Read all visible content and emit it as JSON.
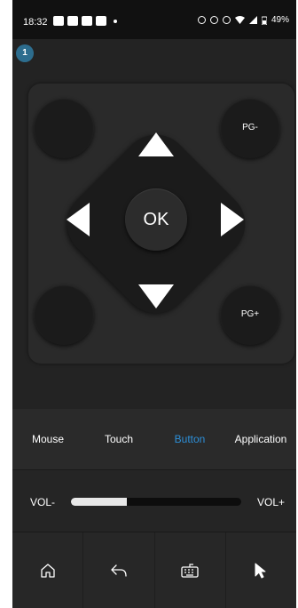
{
  "status_bar": {
    "time": "18:32",
    "battery": "49%"
  },
  "badge": "1",
  "remote": {
    "top_right_label": "PG-",
    "bottom_right_label": "PG+",
    "ok_label": "OK"
  },
  "tabs": [
    {
      "label": "Mouse",
      "active": false
    },
    {
      "label": "Touch",
      "active": false
    },
    {
      "label": "Button",
      "active": true
    },
    {
      "label": "Application",
      "active": false
    }
  ],
  "volume": {
    "minus_label": "VOL-",
    "plus_label": "VOL+",
    "level": 0.33
  },
  "bottom_bar": {
    "items": [
      "home-icon",
      "back-icon",
      "keyboard-icon",
      "cursor-icon"
    ]
  },
  "colors": {
    "accent": "#2d8fd8",
    "background": "#232323",
    "button": "#1b1b1b"
  }
}
